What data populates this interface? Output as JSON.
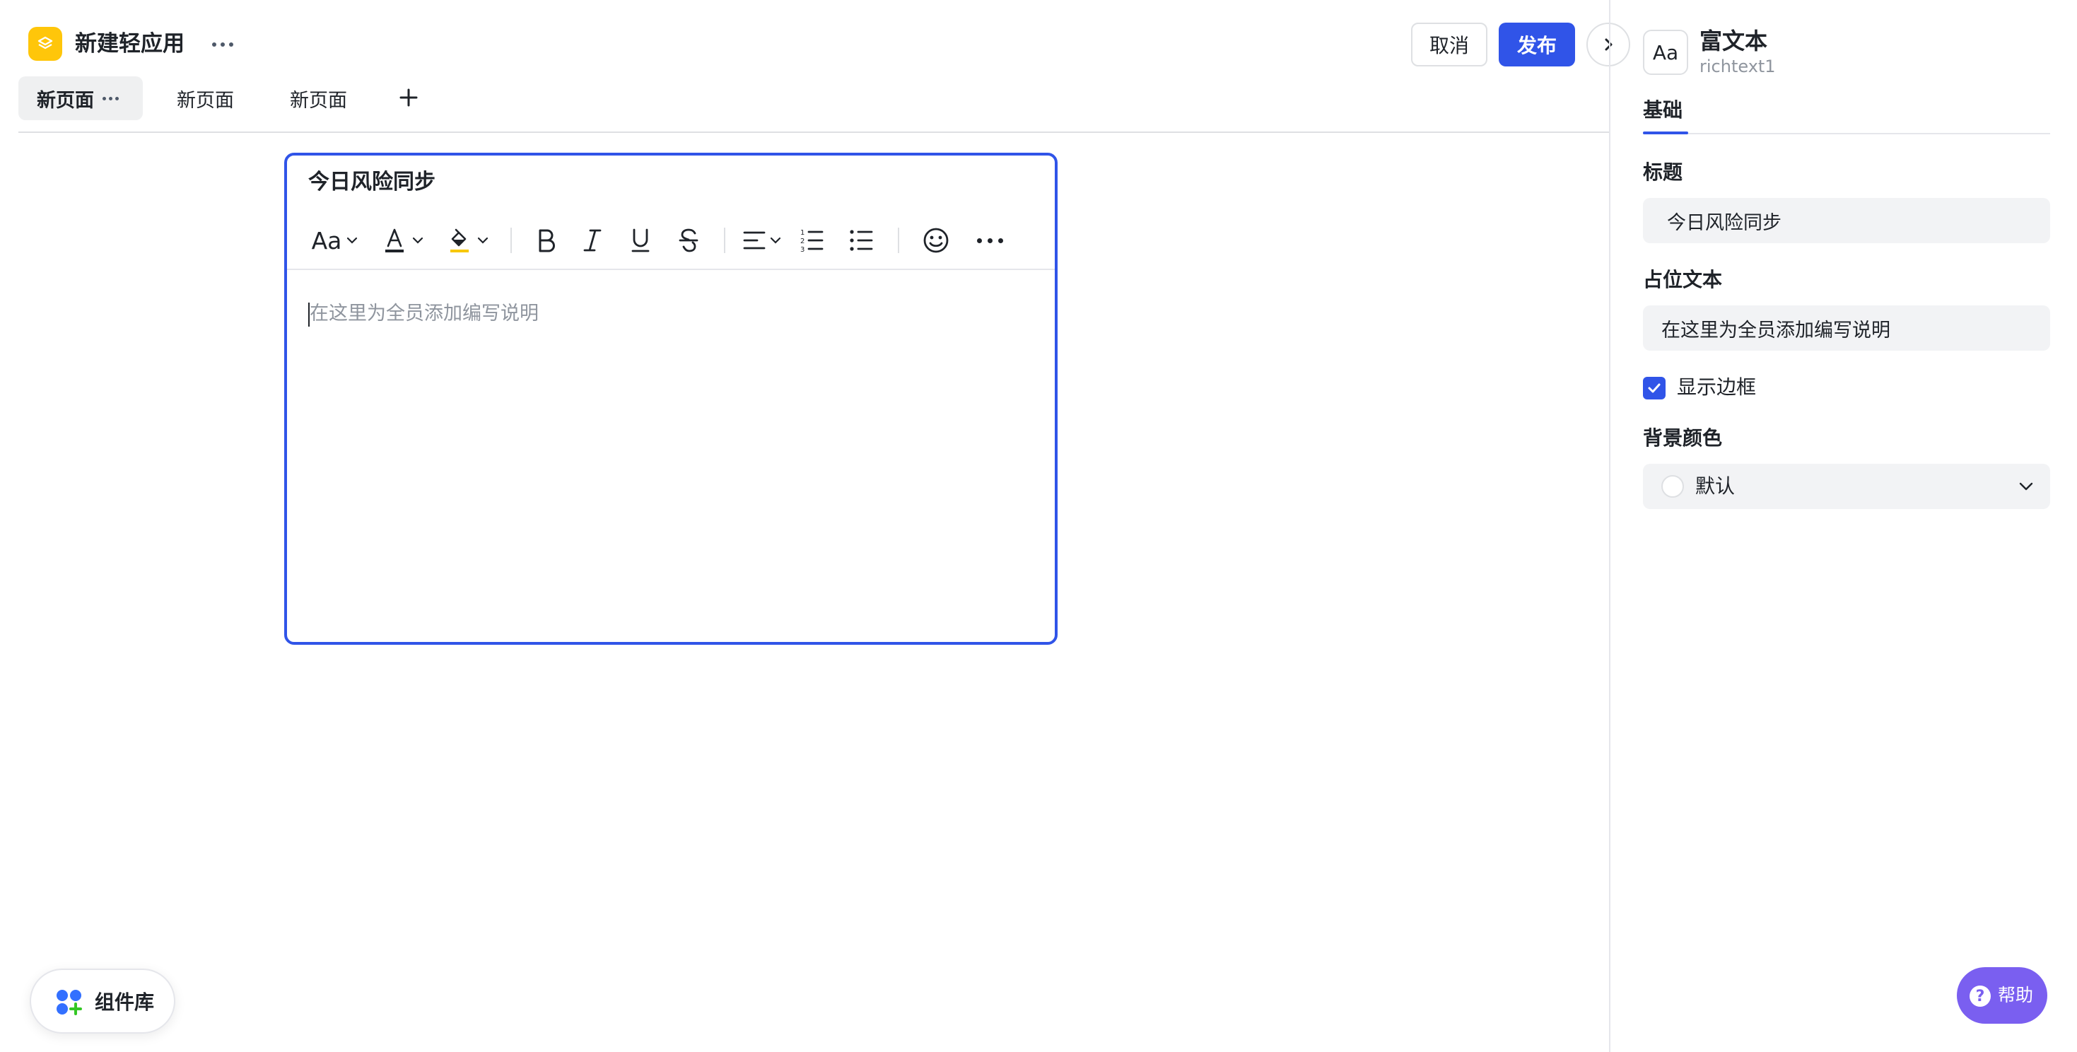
{
  "header": {
    "app_title": "新建轻应用",
    "cancel_label": "取消",
    "publish_label": "发布"
  },
  "page_tabs": [
    {
      "label": "新页面"
    },
    {
      "label": "新页面"
    },
    {
      "label": "新页面"
    }
  ],
  "rich_text_card": {
    "title": "今日风险同步",
    "placeholder": "在这里为全员添加编写说明",
    "toolbar": {
      "font_size_label": "Aa",
      "icons": [
        "font-color-icon",
        "highlight-icon",
        "bold-icon",
        "italic-icon",
        "underline-icon",
        "strikethrough-icon",
        "align-icon",
        "ordered-list-icon",
        "bullet-list-icon",
        "emoji-icon",
        "more-icon"
      ]
    }
  },
  "props_panel": {
    "component_icon_text": "Aa",
    "component_name": "富文本",
    "component_id": "richtext1",
    "tab_label": "基础",
    "title_label": "标题",
    "title_value": "今日风险同步",
    "placeholder_label": "占位文本",
    "placeholder_value": "在这里为全员添加编写说明",
    "show_border_label": "显示边框",
    "show_border_checked": true,
    "bg_color_label": "背景颜色",
    "bg_color_value": "默认"
  },
  "bottom": {
    "component_library_label": "组件库",
    "help_label": "帮助"
  },
  "colors": {
    "accent": "#3054e8",
    "app_icon": "#ffc60a",
    "help_button": "#7a5ff0"
  }
}
